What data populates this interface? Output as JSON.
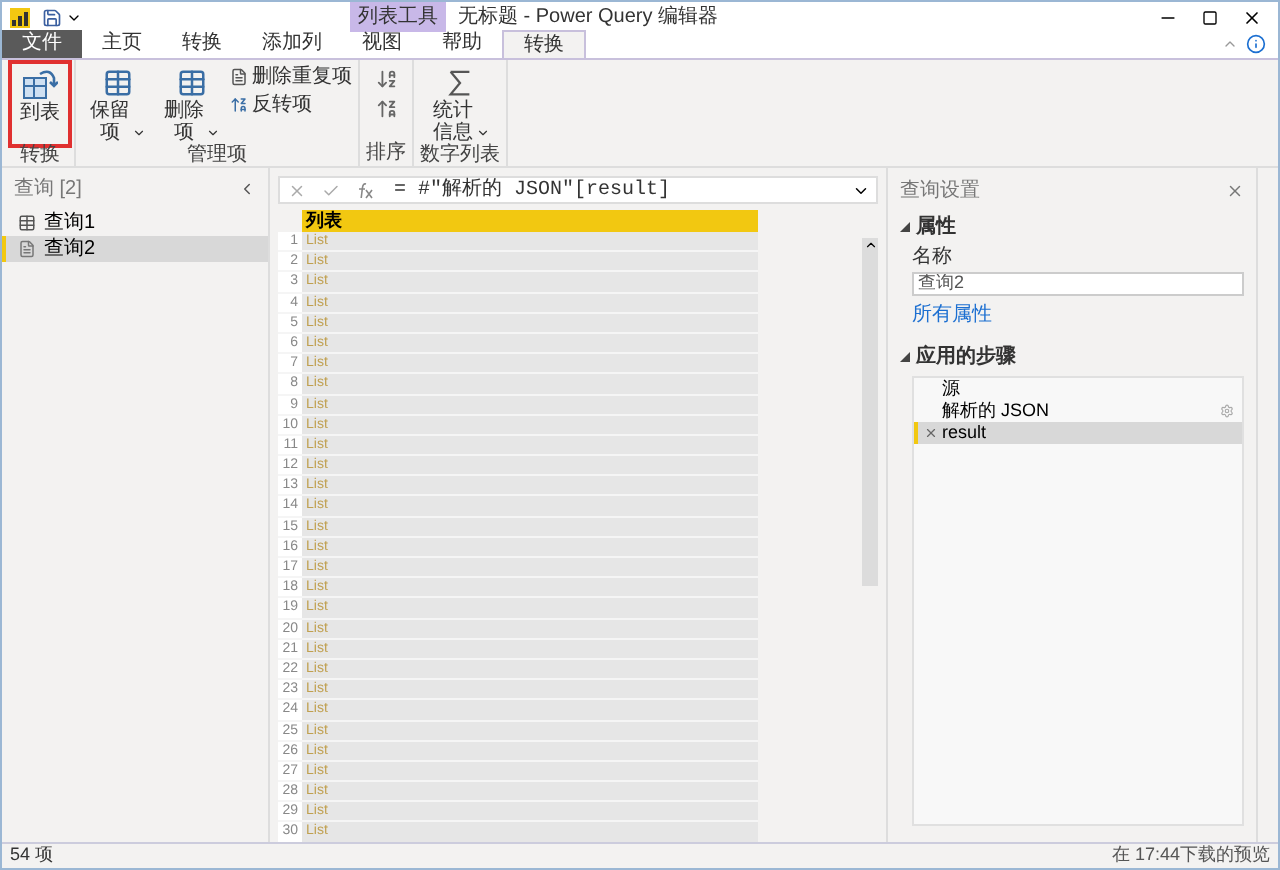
{
  "window": {
    "context_group": "列表工具",
    "title": "无标题 - Power Query 编辑器"
  },
  "ribbon_tabs": [
    {
      "label": "文件",
      "kind": "file",
      "selected": false
    },
    {
      "label": "主页",
      "kind": "normal",
      "selected": false
    },
    {
      "label": "转换",
      "kind": "normal",
      "selected": false
    },
    {
      "label": "添加列",
      "kind": "normal",
      "selected": false
    },
    {
      "label": "视图",
      "kind": "normal",
      "selected": false
    },
    {
      "label": "帮助",
      "kind": "normal",
      "selected": false
    },
    {
      "label": "转换",
      "kind": "context",
      "selected": true
    }
  ],
  "ribbon_groups": [
    {
      "label": "转换",
      "items": [
        {
          "kind": "large",
          "label": "到表",
          "dropdown": false,
          "highlighted": true
        }
      ]
    },
    {
      "label": "管理项",
      "items": [
        {
          "kind": "large",
          "label": "保留项",
          "dropdown": true,
          "highlighted": false
        },
        {
          "kind": "large",
          "label": "删除项",
          "dropdown": true,
          "highlighted": false
        },
        {
          "kind": "small",
          "label": "删除重复项",
          "highlighted": false
        },
        {
          "kind": "small",
          "label": "反转项",
          "highlighted": false
        }
      ]
    },
    {
      "label": "排序",
      "items": [
        {
          "kind": "icon",
          "highlighted": false
        },
        {
          "kind": "icon",
          "highlighted": false
        }
      ]
    },
    {
      "label": "数字列表",
      "items": [
        {
          "kind": "large",
          "label": "统计信息",
          "dropdown": true,
          "highlighted": false
        }
      ]
    }
  ],
  "queries_panel": {
    "title": "查询 [2]",
    "items": [
      {
        "label": "查询1",
        "kind": "table",
        "selected": false
      },
      {
        "label": "查询2",
        "kind": "list",
        "selected": true
      }
    ]
  },
  "formula_bar": {
    "formula": "= #\"解析的 JSON\"[result]"
  },
  "table": {
    "columns": [
      "列表"
    ],
    "rows": [
      {
        "number": "1",
        "value": "List"
      },
      {
        "number": "2",
        "value": "List"
      },
      {
        "number": "3",
        "value": "List"
      },
      {
        "number": "4",
        "value": "List"
      },
      {
        "number": "5",
        "value": "List"
      },
      {
        "number": "6",
        "value": "List"
      },
      {
        "number": "7",
        "value": "List"
      },
      {
        "number": "8",
        "value": "List"
      },
      {
        "number": "9",
        "value": "List"
      },
      {
        "number": "10",
        "value": "List"
      },
      {
        "number": "11",
        "value": "List"
      },
      {
        "number": "12",
        "value": "List"
      },
      {
        "number": "13",
        "value": "List"
      },
      {
        "number": "14",
        "value": "List"
      },
      {
        "number": "15",
        "value": "List"
      },
      {
        "number": "16",
        "value": "List"
      },
      {
        "number": "17",
        "value": "List"
      },
      {
        "number": "18",
        "value": "List"
      },
      {
        "number": "19",
        "value": "List"
      },
      {
        "number": "20",
        "value": "List"
      },
      {
        "number": "21",
        "value": "List"
      },
      {
        "number": "22",
        "value": "List"
      },
      {
        "number": "23",
        "value": "List"
      },
      {
        "number": "24",
        "value": "List"
      },
      {
        "number": "25",
        "value": "List"
      },
      {
        "number": "26",
        "value": "List"
      },
      {
        "number": "27",
        "value": "List"
      },
      {
        "number": "28",
        "value": "List"
      },
      {
        "number": "29",
        "value": "List"
      },
      {
        "number": "30",
        "value": "List"
      }
    ]
  },
  "query_settings": {
    "title": "查询设置",
    "properties_heading": "属性",
    "name_label": "名称",
    "name_value": "查询2",
    "all_properties_link": "所有属性",
    "steps_heading": "应用的步骤",
    "steps": [
      {
        "label": "源",
        "kind": "plain",
        "has_settings": false,
        "selected": false
      },
      {
        "label": "解析的 JSON",
        "kind": "plain",
        "has_settings": true,
        "selected": false
      },
      {
        "label": "result",
        "kind": "navigation",
        "has_settings": false,
        "selected": true
      }
    ]
  },
  "status_bar": {
    "left": "54 项",
    "right": "在 17:44下载的预览"
  }
}
